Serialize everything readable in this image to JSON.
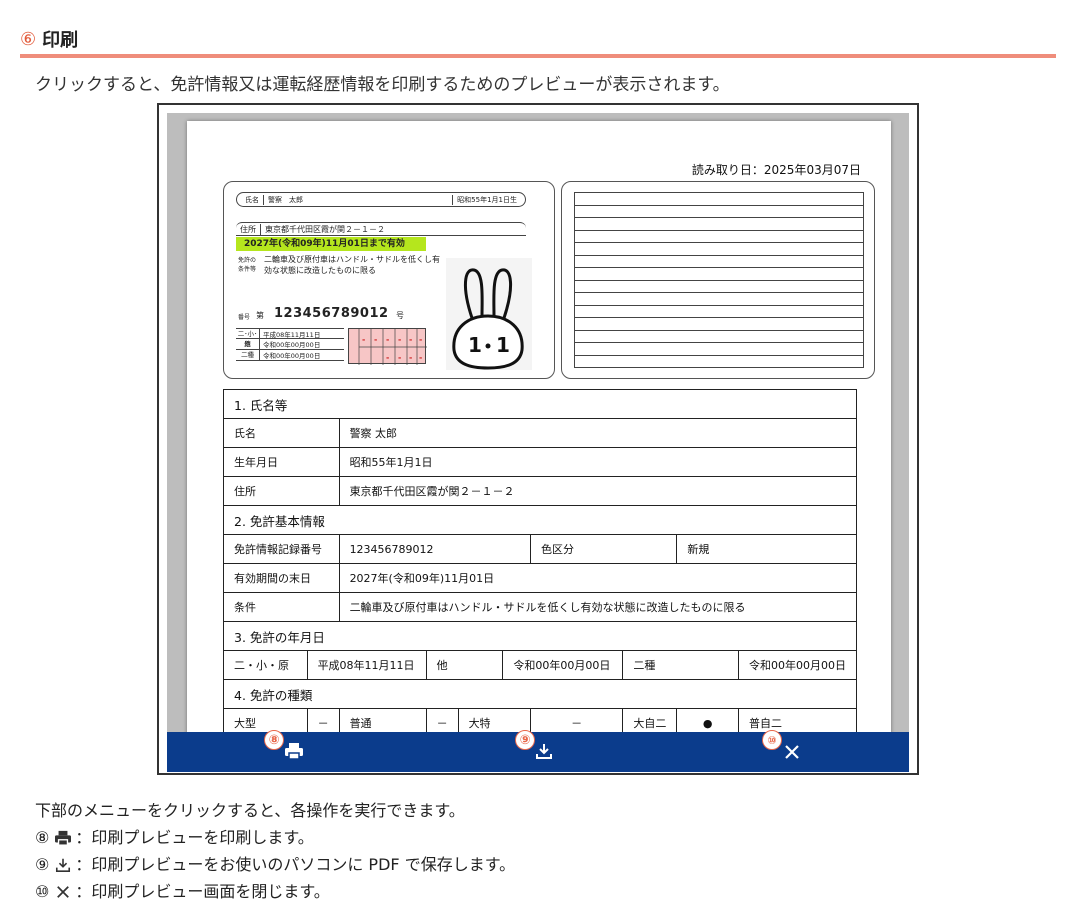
{
  "section": {
    "number": "⑥",
    "title": "印刷"
  },
  "intro": "クリックすると、免許情報又は運転経歴情報を印刷するためのプレビューが表示されます。",
  "preview": {
    "read_date": "読み取り日：2025年03月07日",
    "card": {
      "name_label": "氏名",
      "name": "警察　太郎",
      "birth": "昭和55年1月1日生",
      "addr_label": "住所",
      "address": "東京都千代田区霞が関２－１－２",
      "expiry": "2027年(令和09年)11月01日まで有効",
      "cond_label": "免許の条件等",
      "conditions": "二輪車及び原付車はハンドル・サドルを低くし有効な状態に改造したものに限る",
      "num_label": "番号",
      "num_dai": "第",
      "number": "123456789012",
      "num_go": "号",
      "dates": [
        {
          "label": "二･小･原",
          "value": "平成08年11月11日"
        },
        {
          "label": "他",
          "value": "令和00年00月00日"
        },
        {
          "label": "二種",
          "value": "令和00年00月00日"
        }
      ]
    },
    "table": {
      "sec1": "1. 氏名等",
      "name_label": "氏名",
      "name_value": "警察 太郎",
      "birth_label": "生年月日",
      "birth_value": "昭和55年1月1日",
      "addr_label": "住所",
      "addr_value": "東京都千代田区霞が関２－１－２",
      "sec2": "2. 免許基本情報",
      "rec_label": "免許情報記録番号",
      "rec_value": "123456789012",
      "color_label": "色区分",
      "color_value": "新規",
      "exp_label": "有効期間の末日",
      "exp_value": "2027年(令和09年)11月01日",
      "cond_label": "条件",
      "cond_value": "二輪車及び原付車はハンドル・サドルを低くし有効な状態に改造したものに限る",
      "sec3": "3. 免許の年月日",
      "d1_label": "二・小・原",
      "d1_value": "平成08年11月11日",
      "d2_label": "他",
      "d2_value": "令和00年00月00日",
      "d3_label": "二種",
      "d3_value": "令和00年00月00日",
      "sec4": "4. 免許の種類",
      "types": [
        {
          "label": "大型",
          "mark": "－"
        },
        {
          "label": "普通",
          "mark": "－"
        },
        {
          "label": "大特",
          "mark": "－"
        },
        {
          "label": "大自二",
          "mark": "●"
        },
        {
          "label": "普自二",
          "mark": "●"
        }
      ]
    },
    "bar": {
      "badges": [
        "⑧",
        "⑨",
        "⑩"
      ]
    }
  },
  "footer": {
    "lead": "下部のメニューをクリックすると、各操作を実行できます。",
    "items": [
      {
        "num": "⑧",
        "text": "：印刷プレビューを印刷します。"
      },
      {
        "num": "⑨",
        "text": "：印刷プレビューをお使いのパソコンに PDF で保存します。"
      },
      {
        "num": "⑩",
        "text": "：印刷プレビュー画面を閉じます。"
      }
    ]
  },
  "colors": {
    "accent": "#ef8d7b",
    "bar": "#0b3c8c",
    "highlight": "#b5e61d"
  },
  "icons": [
    "printer-icon",
    "download-icon",
    "close-icon"
  ]
}
